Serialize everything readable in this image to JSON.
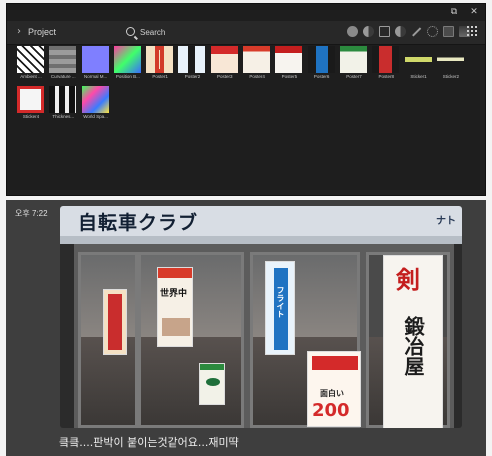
{
  "window": {
    "maximize_glyph": "⧉",
    "close_glyph": "✕"
  },
  "toolbar": {
    "breadcrumb": "Project",
    "search_placeholder": "Search"
  },
  "assets": [
    {
      "label": "Ambient ...",
      "thumb": "ambient"
    },
    {
      "label": "Curvature ...",
      "thumb": "curvature"
    },
    {
      "label": "Normal M...",
      "thumb": "normal"
    },
    {
      "label": "Position B...",
      "thumb": "position"
    },
    {
      "label": "Poster1",
      "thumb": "poster1"
    },
    {
      "label": "Poster2",
      "thumb": "poster2"
    },
    {
      "label": "Poster3",
      "thumb": "poster3"
    },
    {
      "label": "Poster4",
      "thumb": "poster4"
    },
    {
      "label": "Poster5",
      "thumb": "poster5"
    },
    {
      "label": "Poster6",
      "thumb": "poster6"
    },
    {
      "label": "Poster7",
      "thumb": "poster7"
    },
    {
      "label": "Poster8",
      "thumb": "poster8"
    },
    {
      "label": "Sticker1",
      "thumb": "sticker1"
    },
    {
      "label": "Sticker2",
      "thumb": "sticker2"
    },
    {
      "label": "Sticker4",
      "thumb": "sticker4"
    },
    {
      "label": "Thicknes...",
      "thumb": "thickness"
    },
    {
      "label": "World Spa...",
      "thumb": "worldspace"
    }
  ],
  "chat": {
    "time": "오후 7:22",
    "caption": "킄킄....판박이 붙이는것같어요...재미땩",
    "photo": {
      "sign_text": "自転車クラブ",
      "sign_right": "ナト",
      "poster_sword": "剣",
      "poster_vertical": "鍛冶屋",
      "poster_world": "世界中",
      "poster_flight": "フライト",
      "poster_price": "200",
      "poster_fun": "面白い"
    }
  }
}
